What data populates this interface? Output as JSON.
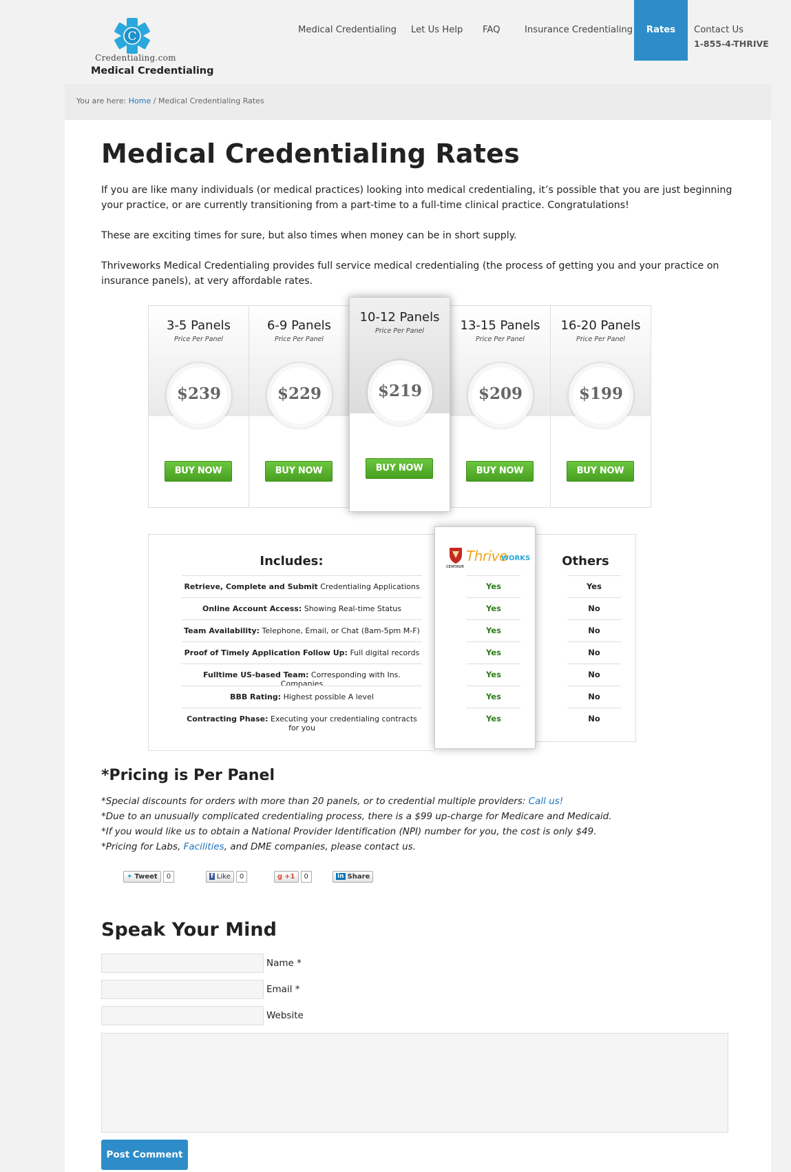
{
  "header": {
    "logo_text": "Credentialing.com",
    "site_title": "Medical Credentialing",
    "nav": [
      {
        "label": "Medical Credentialing"
      },
      {
        "label": "Let Us Help"
      },
      {
        "label": "FAQ"
      },
      {
        "label": "Insurance Credentialing"
      },
      {
        "label": "Rates"
      },
      {
        "label": "Contact Us",
        "sub": "1-855-4-THRIVE"
      }
    ],
    "active_nav": "Rates",
    "accent_color": "#2e8dc8"
  },
  "breadcrumb": {
    "prefix": "You are here:",
    "home": "Home",
    "separator": "/",
    "current": "Medical Credentialing Rates"
  },
  "page": {
    "title": "Medical Credentialing Rates",
    "paragraphs": [
      "If you are like many individuals (or medical practices) looking into medical credentialing, it’s possible that you are just beginning your practice, or are currently transitioning from a part-time to a full-time clinical practice. Congratulations!",
      "These are exciting times for sure, but also times when money can be in short supply.",
      "Thriveworks Medical Credentialing provides full service medical credentialing (the process of getting you and your practice on insurance panels), at very affordable rates."
    ]
  },
  "pricing": {
    "per_label": "Price Per Panel",
    "buy_label": "BUY NOW",
    "plans": [
      {
        "name": "3-5 Panels",
        "price": "$239"
      },
      {
        "name": "6-9 Panels",
        "price": "$229"
      },
      {
        "name": "10-12 Panels",
        "price": "$219",
        "featured": true
      },
      {
        "name": "13-15 Panels",
        "price": "$209"
      },
      {
        "name": "16-20 Panels",
        "price": "$199"
      }
    ],
    "buy_color": "#5cb531"
  },
  "comparison": {
    "includes_heading": "Includes:",
    "brand_small": "CENTAUR",
    "brand_name_1": "Thrive",
    "brand_name_2": "WORKS",
    "others_heading": "Others",
    "features": [
      {
        "bold": "Retrieve, Complete and Submit",
        "rest": " Credentialing Applications",
        "thrive": "Yes",
        "others": "Yes"
      },
      {
        "bold": "Online Account Access:",
        "rest": " Showing Real-time Status",
        "thrive": "Yes",
        "others": "No"
      },
      {
        "bold": "Team Availability:",
        "rest": " Telephone, Email, or Chat (8am-5pm M-F)",
        "thrive": "Yes",
        "others": "No"
      },
      {
        "bold": "Proof of Timely Application Follow Up:",
        "rest": " Full digital records",
        "thrive": "Yes",
        "others": "No"
      },
      {
        "bold": "Fulltime US-based Team:",
        "rest": " Corresponding with Ins. Companies",
        "thrive": "Yes",
        "others": "No"
      },
      {
        "bold": "BBB Rating:",
        "rest": " Highest possible A level",
        "thrive": "Yes",
        "others": "No"
      },
      {
        "bold": "Contracting Phase:",
        "rest": " Executing your credentialing contracts for you",
        "thrive": "Yes",
        "others": "No"
      }
    ]
  },
  "notes": {
    "heading": "*Pricing is Per Panel",
    "line1": "*Special discounts for orders with more than 20 panels, or to credential multiple providers: ",
    "line1_link": "Call us!",
    "line2": "*Due to an unusually complicated credentialing process, there is a $99 up-charge for Medicare and Medicaid.",
    "line3": "*If you would like us to obtain a National Provider Identification (NPI) number for you, the cost is only $49.",
    "line4a": "*Pricing for Labs, ",
    "line4_link": "Facilities",
    "line4b": ", and DME companies, please contact us."
  },
  "social": {
    "tweet": "Tweet",
    "tweet_count": "0",
    "like": "Like",
    "like_count": "0",
    "plus": "+1",
    "plus_count": "0",
    "share": "Share"
  },
  "comments": {
    "heading": "Speak Your Mind",
    "name_label": "Name *",
    "email_label": "Email *",
    "website_label": "Website",
    "submit": "Post Comment"
  }
}
